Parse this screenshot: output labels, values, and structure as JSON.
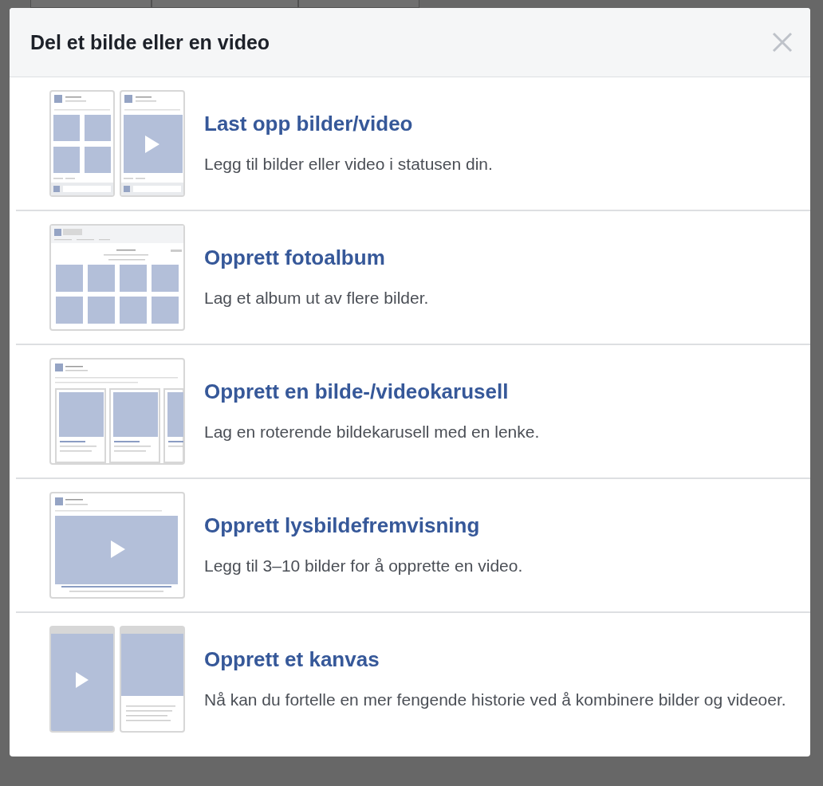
{
  "dialog": {
    "title": "Del et bilde eller en video"
  },
  "options": [
    {
      "kind": "photo-video",
      "title": "Last opp bilder/video",
      "description": "Legg til bilder eller video i statusen din."
    },
    {
      "kind": "album",
      "title": "Opprett fotoalbum",
      "description": "Lag et album ut av flere bilder."
    },
    {
      "kind": "carousel",
      "title": "Opprett en bilde-/videokarusell",
      "description": "Lag en roterende bildekarusell med en lenke."
    },
    {
      "kind": "slideshow",
      "title": "Opprett lysbildefremvisning",
      "description": "Legg til 3–10 bilder for å opprette en video."
    },
    {
      "kind": "canvas",
      "title": "Opprett et kanvas",
      "description": "Nå kan du fortelle en mer fengende historie ved å kombinere bilder og videoer."
    }
  ]
}
